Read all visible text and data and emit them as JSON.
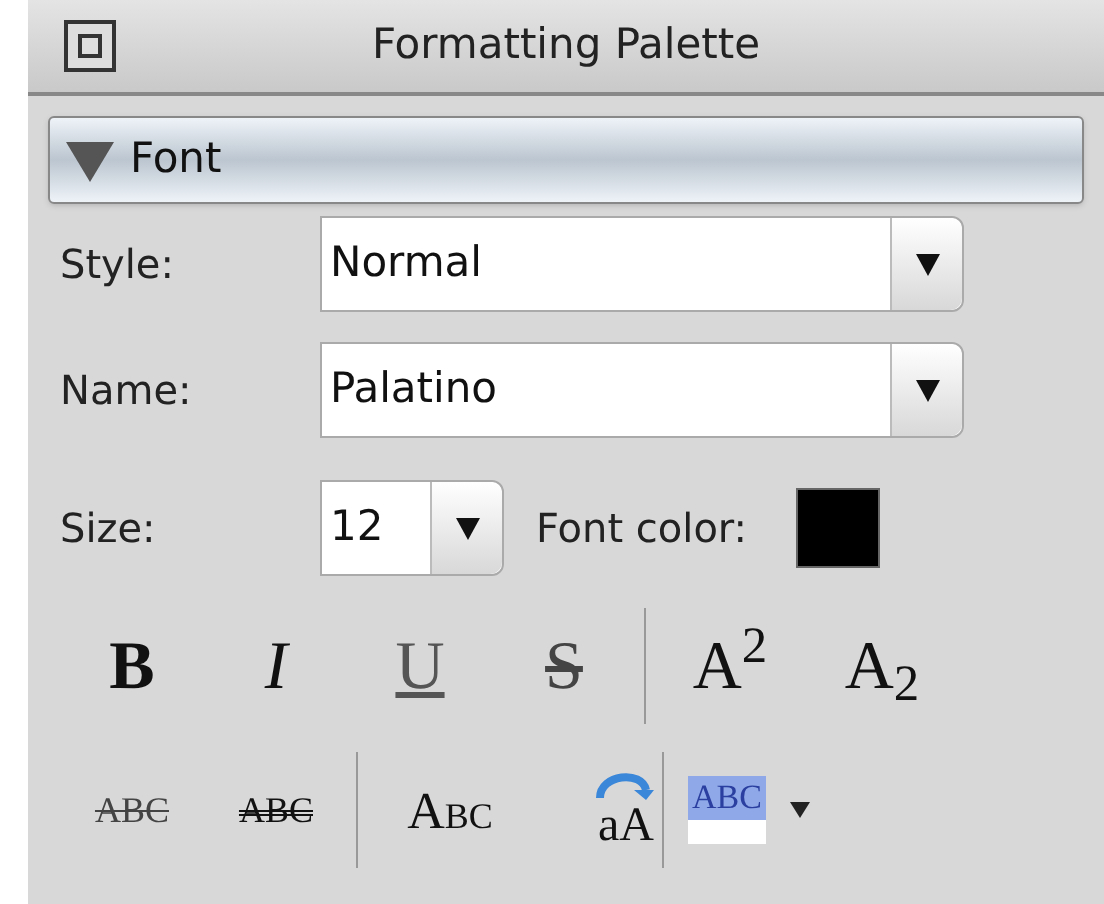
{
  "window": {
    "title": "Formatting Palette"
  },
  "section": {
    "title": "Font",
    "expanded": true
  },
  "fields": [
    {
      "label": "Style:",
      "value": "Normal"
    },
    {
      "label": "Name:",
      "value": "Palatino"
    }
  ],
  "size": {
    "label": "Size:",
    "value": "12"
  },
  "font_color": {
    "label": "Font color:",
    "color": "#000000"
  },
  "toolbar_rows": [
    [
      {
        "kind": "bold",
        "label": "B"
      },
      {
        "kind": "italic",
        "label": "I"
      },
      {
        "kind": "underline",
        "label": "U"
      },
      {
        "kind": "strike",
        "label": "S"
      },
      {
        "kind": "separator"
      },
      {
        "kind": "text",
        "label": "A$^{2}$"
      },
      {
        "kind": "text",
        "label": "A$_{2}$"
      }
    ],
    [
      {
        "kind": "strike",
        "label": "ABC"
      },
      {
        "kind": "double_strike",
        "label": "ABC"
      },
      {
        "kind": "separator"
      },
      {
        "kind": "small_caps",
        "label": "Abc"
      },
      {
        "kind": "change_case",
        "label": "aA"
      },
      {
        "kind": "separator"
      },
      {
        "kind": "highlight",
        "label": "ABC"
      }
    ]
  ]
}
